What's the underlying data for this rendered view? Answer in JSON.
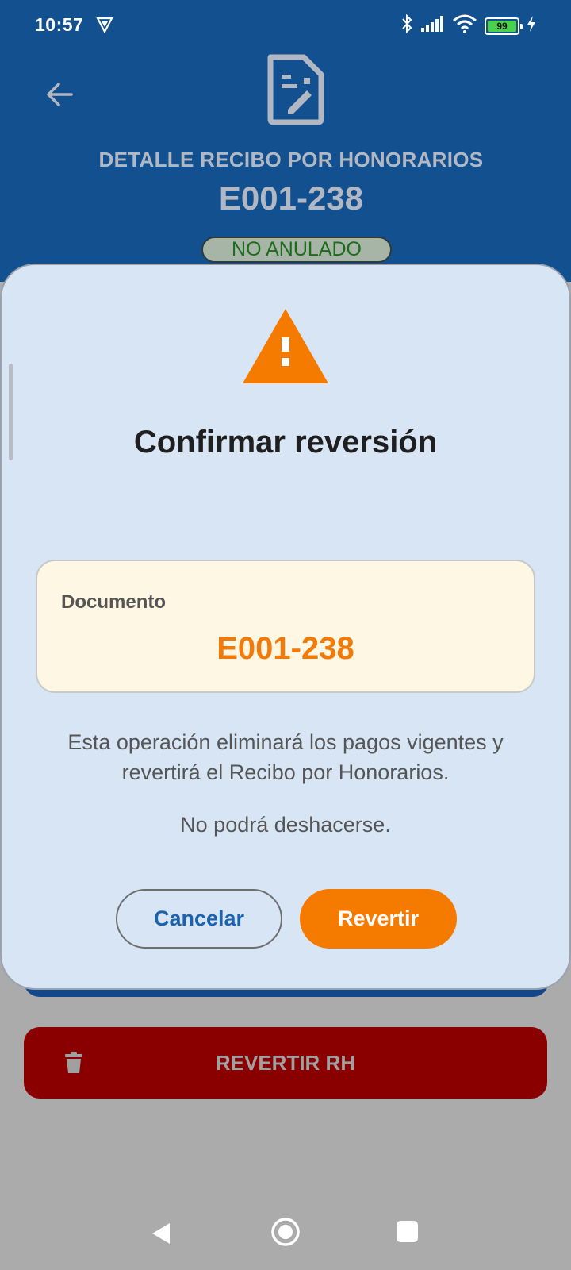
{
  "status_bar": {
    "time": "10:57",
    "battery_level": "99"
  },
  "header": {
    "title": "DETALLE RECIBO POR HONORARIOS",
    "document_number": "E001-238",
    "status_badge": "NO ANULADO"
  },
  "actions": {
    "revert_rh_label": "REVERTIR RH"
  },
  "dialog": {
    "title": "Confirmar reversión",
    "document_label": "Documento",
    "document_value": "E001-238",
    "message_line1": "Esta operación eliminará los pagos vigentes y",
    "message_line2": "revertirá el Recibo por Honorarios.",
    "note": "No podrá deshacerse.",
    "cancel_label": "Cancelar",
    "confirm_label": "Revertir"
  },
  "colors": {
    "header_bg": "#12508f",
    "accent_orange": "#f57a00",
    "danger": "#8a0000",
    "dialog_bg": "#d8e5f5"
  }
}
